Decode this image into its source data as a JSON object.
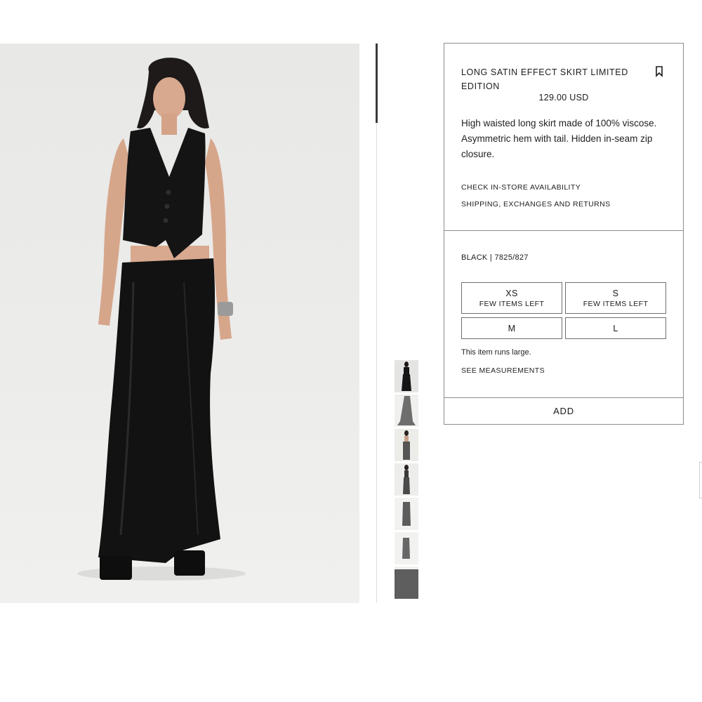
{
  "product": {
    "title": "LONG SATIN EFFECT SKIRT LIMITED EDITION",
    "price": "129.00 USD",
    "description": "High waisted long skirt made of 100% viscose. Asymmetric hem with tail. Hidden in-seam zip closure.",
    "check_store_label": "CHECK IN-STORE AVAILABILITY",
    "shipping_label": "SHIPPING, EXCHANGES AND RETURNS",
    "color_ref": "BLACK | 7825/827",
    "sizes": [
      {
        "label": "XS",
        "note": "FEW ITEMS LEFT"
      },
      {
        "label": "S",
        "note": "FEW ITEMS LEFT"
      },
      {
        "label": "M",
        "note": ""
      },
      {
        "label": "L",
        "note": ""
      }
    ],
    "fit_note": "This item runs large.",
    "measurements_label": "SEE MEASUREMENTS",
    "add_label": "ADD"
  },
  "icons": {
    "bookmark": "bookmark-icon"
  },
  "gallery": {
    "thumbnail_count": 7,
    "active_index": 0
  },
  "colors": {
    "border": "#8d8d8d",
    "garment": "#141414",
    "background_photo": "#ececea"
  }
}
